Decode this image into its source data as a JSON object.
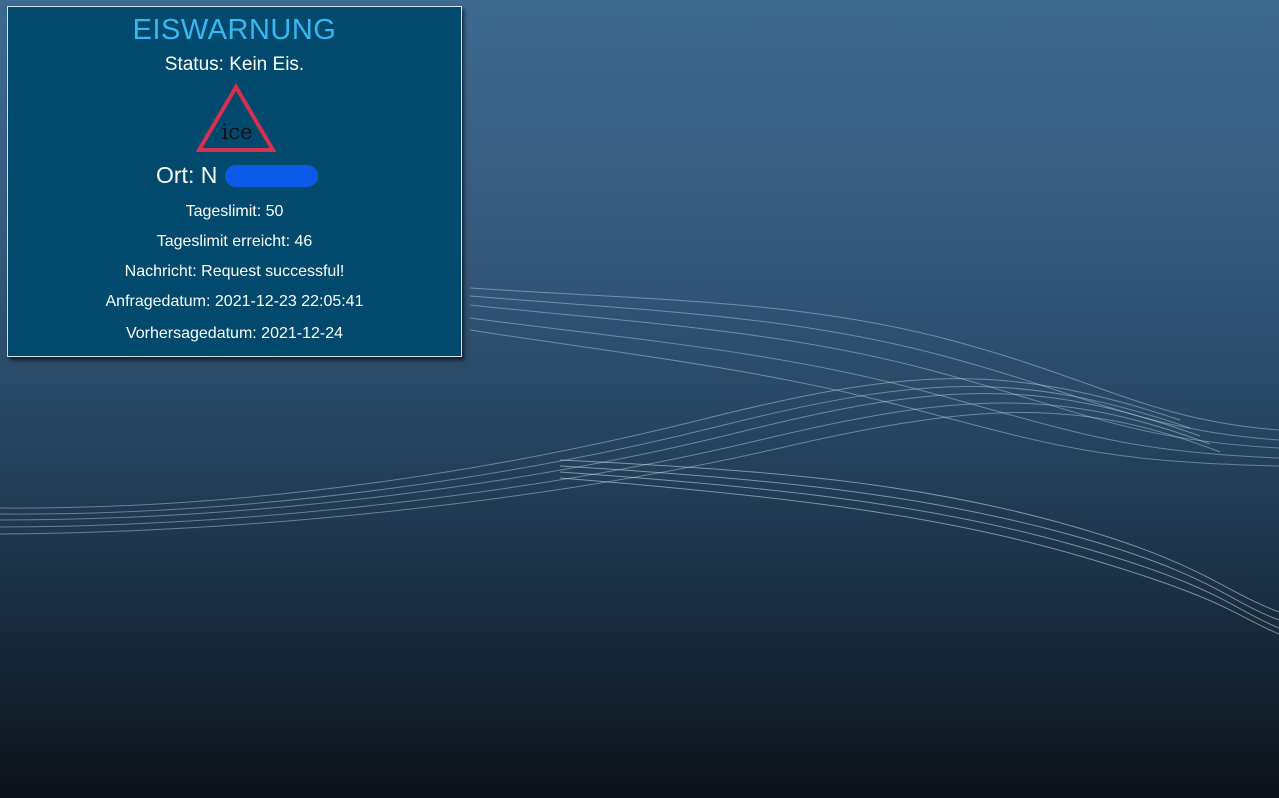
{
  "widget": {
    "title": "EISWARNUNG",
    "status_label": "Status:",
    "status_value": "Kein Eis.",
    "icon": {
      "name": "ice-warning-triangle-icon",
      "text": "ice",
      "stroke_color": "#d4304f"
    },
    "location_label": "Ort:",
    "location_value_visible": "N",
    "rows": [
      {
        "label": "Tageslimit:",
        "value": "50"
      },
      {
        "label": "Tageslimit erreicht:",
        "value": "46"
      },
      {
        "label": "Nachricht:",
        "value": "Request successful!"
      },
      {
        "label": "Anfragedatum:",
        "value": "2021-12-23 22:05:41"
      },
      {
        "label": "Vorhersagedatum:",
        "value": "2021-12-24"
      }
    ]
  },
  "colors": {
    "widget_background": "#02496e",
    "title_color": "#35b8f3",
    "redaction_color": "#0b5be8"
  }
}
